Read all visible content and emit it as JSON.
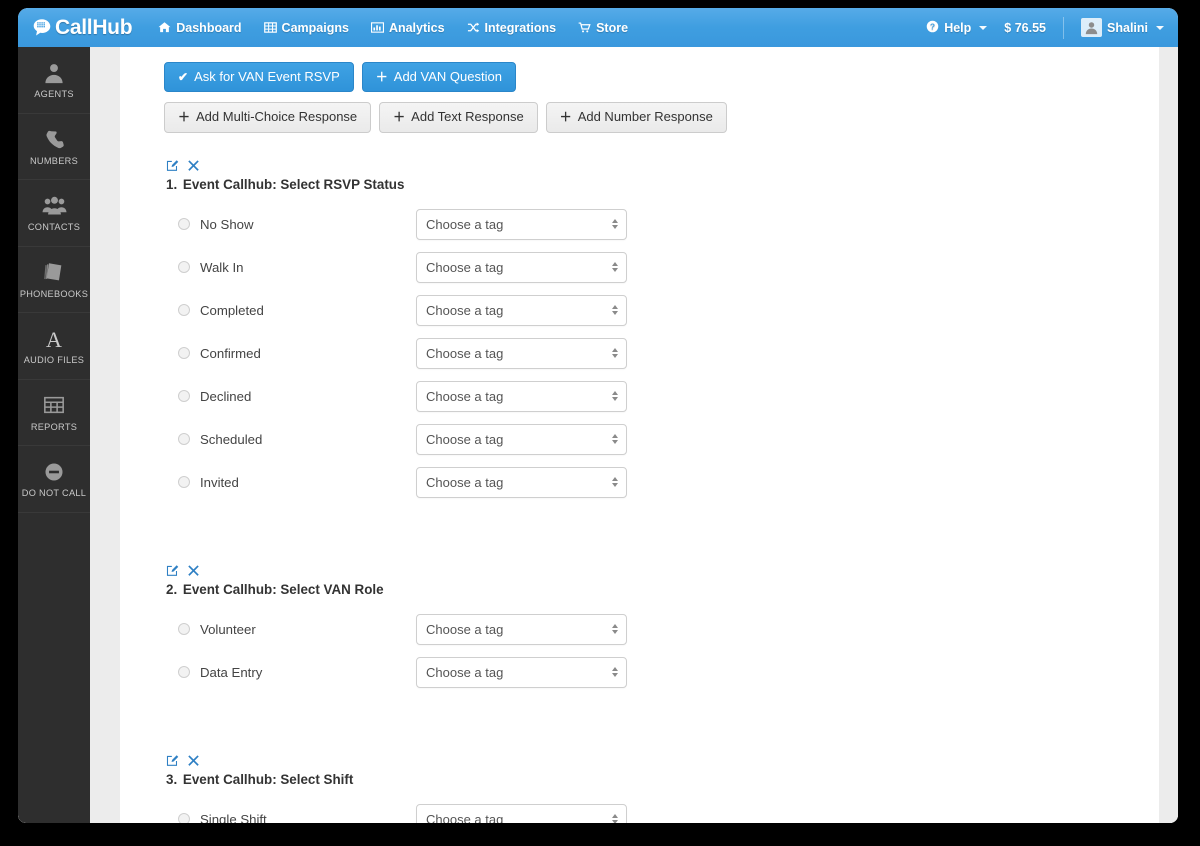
{
  "app": {
    "brand": "CallHub",
    "brand_icon": "callhub-speech-bubble-icon"
  },
  "navbar": {
    "links": [
      {
        "label": "Dashboard",
        "icon": "home-icon"
      },
      {
        "label": "Campaigns",
        "icon": "grid-table-icon"
      },
      {
        "label": "Analytics",
        "icon": "bar-chart-icon"
      },
      {
        "label": "Integrations",
        "icon": "shuffle-icon"
      },
      {
        "label": "Store",
        "icon": "shopping-cart-icon"
      }
    ],
    "help": {
      "label": "Help",
      "icon": "question-circle-icon"
    },
    "balance": "$ 76.55",
    "user": {
      "name": "Shalini",
      "icon": "user-avatar-icon"
    }
  },
  "sidebar": {
    "items": [
      {
        "label": "AGENTS",
        "icon": "person-icon"
      },
      {
        "label": "NUMBERS",
        "icon": "phone-icon"
      },
      {
        "label": "CONTACTS",
        "icon": "people-group-icon"
      },
      {
        "label": "PHONEBOOKS",
        "icon": "book-icon"
      },
      {
        "label": "AUDIO FILES",
        "icon": "letter-a-icon"
      },
      {
        "label": "REPORTS",
        "icon": "table-grid-icon"
      },
      {
        "label": "DO NOT CALL",
        "icon": "minus-circle-icon"
      }
    ]
  },
  "toolbar": {
    "primary_buttons": [
      {
        "label": "Ask for VAN Event RSVP",
        "glyph": "✔",
        "icon": "check-icon"
      },
      {
        "label": "Add VAN Question",
        "glyph": "＋",
        "icon": "plus-icon"
      }
    ],
    "secondary_buttons": [
      {
        "label": "Add Multi-Choice Response",
        "glyph": "＋",
        "icon": "plus-icon"
      },
      {
        "label": "Add Text Response",
        "glyph": "＋",
        "icon": "plus-icon"
      },
      {
        "label": "Add Number Response",
        "glyph": "＋",
        "icon": "plus-icon"
      }
    ]
  },
  "select_placeholder": "Choose a tag",
  "tools": {
    "edit_icon": "edit-pencil-square-icon",
    "delete_icon": "close-x-icon",
    "delete_glyph": "✖"
  },
  "colors": {
    "brand_blue": "#3f9ee0",
    "link_blue": "#2f80c4",
    "sidebar_dark": "#2e2e2e",
    "page_gray": "#ececec"
  },
  "questions": [
    {
      "number": "1.",
      "title": "Event Callhub: Select RSVP Status",
      "options": [
        {
          "label": "No Show"
        },
        {
          "label": "Walk In"
        },
        {
          "label": "Completed"
        },
        {
          "label": "Confirmed"
        },
        {
          "label": "Declined"
        },
        {
          "label": "Scheduled"
        },
        {
          "label": "Invited"
        }
      ]
    },
    {
      "number": "2.",
      "title": "Event Callhub: Select VAN Role",
      "options": [
        {
          "label": "Volunteer"
        },
        {
          "label": "Data Entry"
        }
      ]
    },
    {
      "number": "3.",
      "title": "Event Callhub: Select Shift",
      "options": [
        {
          "label": "Single Shift"
        }
      ]
    }
  ]
}
